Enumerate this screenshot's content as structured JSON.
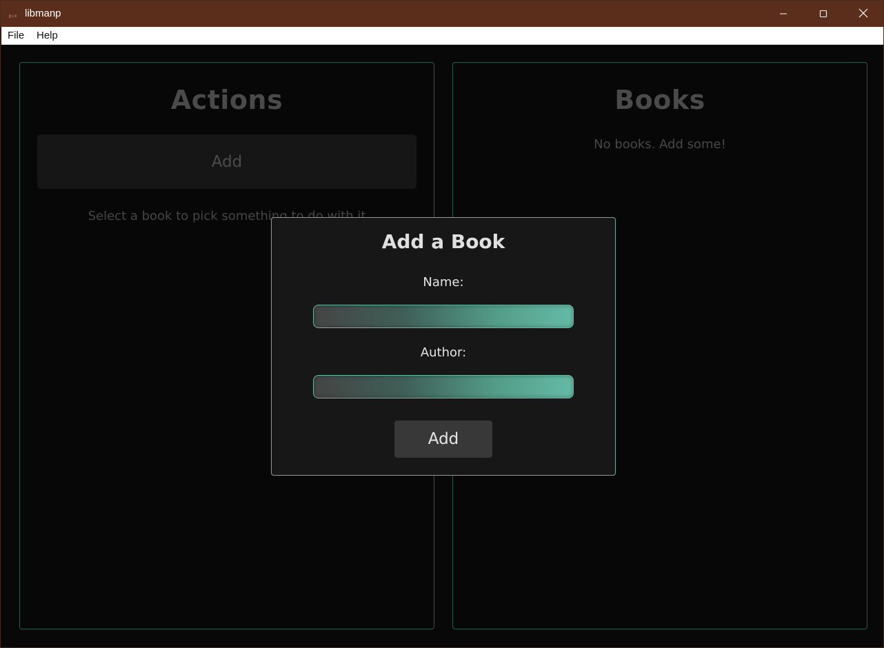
{
  "window": {
    "title": "libmanp",
    "titlebar_color": "#5b2e1c",
    "accent_color": "#5bb39c"
  },
  "menubar": {
    "items": [
      "File",
      "Help"
    ]
  },
  "actions_panel": {
    "title": "Actions",
    "add_label": "Add",
    "hint": "Select a book to pick something to do with it"
  },
  "books_panel": {
    "title": "Books",
    "empty_message": "No books. Add some!"
  },
  "add_dialog": {
    "title": "Add a Book",
    "name_label": "Name:",
    "name_value": "",
    "author_label": "Author:",
    "author_value": "",
    "submit_label": "Add"
  },
  "icons": {
    "app": "app-icon",
    "minimize": "minimize-icon",
    "maximize": "maximize-icon",
    "close": "close-icon"
  }
}
